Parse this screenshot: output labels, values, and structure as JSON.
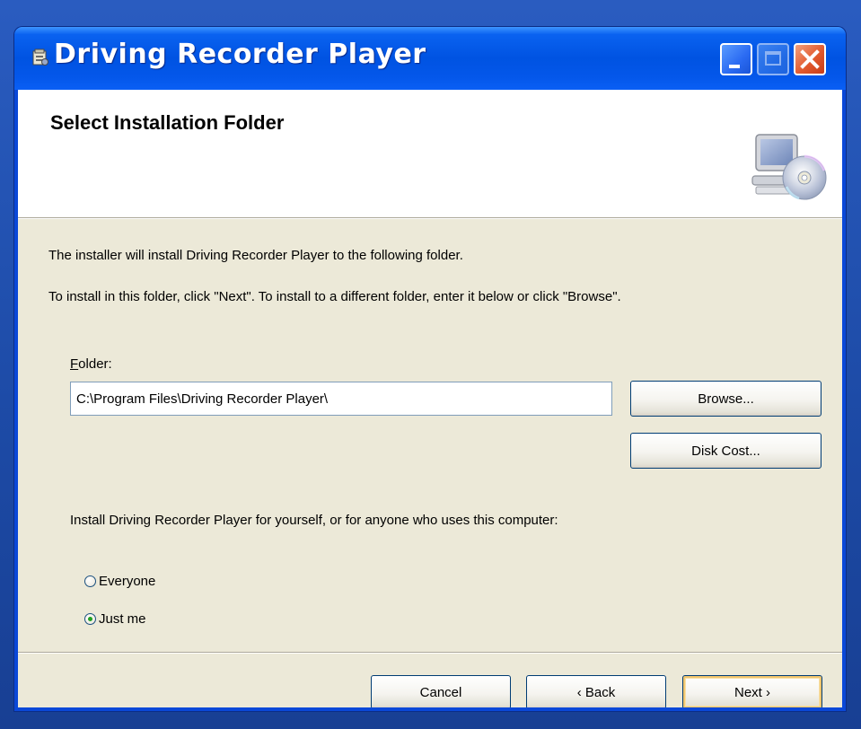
{
  "window": {
    "title": "Driving Recorder Player",
    "accent_color": "#0053e2",
    "close_color": "#e25a2e"
  },
  "header": {
    "title": "Select Installation Folder",
    "icon": "computer-cd-icon"
  },
  "body": {
    "intro": "The installer will install Driving Recorder Player to the following folder.",
    "instructions": "To install in this folder, click \"Next\". To install to a different folder, enter it below or click \"Browse\"."
  },
  "folder": {
    "label_mnemonic": "F",
    "label_rest": "older:",
    "value": "C:\\Program Files\\Driving Recorder Player\\",
    "browse_label": "Browse...",
    "disk_cost_label": "Disk Cost..."
  },
  "install_for": {
    "prompt": "Install Driving Recorder Player for yourself, or for anyone who uses this computer:",
    "options": [
      {
        "label": "Everyone",
        "checked": false
      },
      {
        "label": "Just me",
        "checked": true
      }
    ]
  },
  "footer": {
    "cancel_label": "Cancel",
    "back_label": "‹ Back",
    "next_label": "Next ›"
  }
}
